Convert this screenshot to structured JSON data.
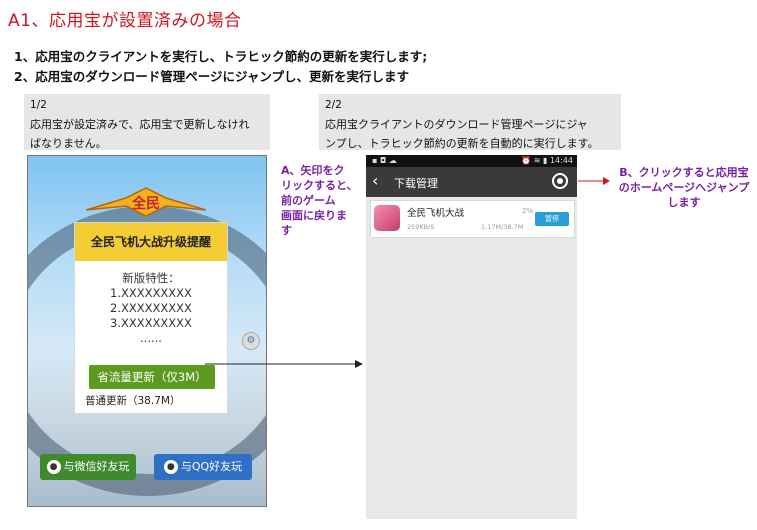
{
  "title": "A1、応用宝が設置済みの場合",
  "steps": [
    "1、応用宝のクライアントを実行し、トラヒック節約の更新を実行します;",
    "2、応用宝のダウンロード管理ページにジャンプし、更新を実行します"
  ],
  "captions": [
    {
      "num": "1/2",
      "line1": "応用宝が設定済みで、応用宝で更新しなけれ",
      "line2": "ばなりません。"
    },
    {
      "num": "2/2",
      "line1": "応用宝クライアントのダウンロード管理ページにジャ",
      "line2": "ンプし、トラヒック節約の更新を自動的に実行します。"
    }
  ],
  "game": {
    "logo": "全民",
    "popup_title": "全民飞机大战升级提醒",
    "features_title": "新版特性：",
    "features": [
      "1.XXXXXXXXX",
      "2.XXXXXXXXX",
      "3.XXXXXXXXX",
      "......"
    ],
    "save_update": "省流量更新（仅3M）",
    "normal_update": "普通更新（38.7M）",
    "share_wechat": "与微信好友玩",
    "share_qq": "与QQ好友玩"
  },
  "phone": {
    "status_time": "14:44",
    "page_title": "下载管理",
    "app_name": "全民飞机大战",
    "percent": "2%",
    "speed": "259KB/S",
    "size": "1.17M/38.7M",
    "pause": "暂停"
  },
  "annotations": {
    "a": [
      "A、矢印をク",
      "リックすると、",
      "前のゲーム",
      "画面に戻りま",
      "す"
    ],
    "b": [
      "B、クリックすると応用宝",
      "のホームページへジャンプ",
      "します"
    ]
  },
  "colors": {
    "title": "#d2141e",
    "annotation": "#7b1fa2",
    "save_button": "#5d9a20",
    "pause_button": "#2a9fd6"
  }
}
